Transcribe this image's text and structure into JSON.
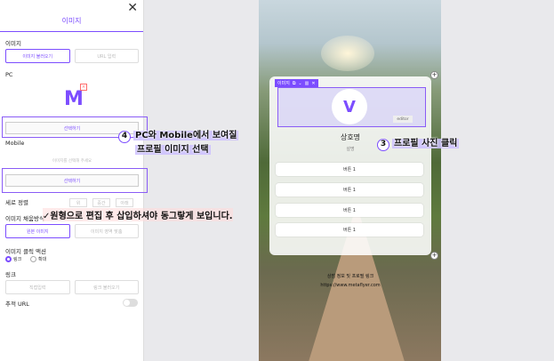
{
  "panel": {
    "title": "이미지",
    "section_image": "이미지",
    "image_tabs": [
      "이미지 불러오기",
      "URL 입력"
    ],
    "pc_label": "PC",
    "logo_letter": "M",
    "select_button_pc": "선택하기",
    "mobile_label": "Mobile",
    "mobile_hint": "이미지를 선택해 주세요",
    "select_button_mobile": "선택하기",
    "vertical_align_label": "세로 정렬",
    "vertical_align_options": [
      "위",
      "중간",
      "아래"
    ],
    "fill_label": "이미지 채움방식",
    "fill_options": [
      "원본 이미지",
      "이미지 영역 맞춤"
    ],
    "click_action_label": "이미지 클릭 액션",
    "click_action_options": [
      "링크",
      "확대"
    ],
    "link_label": "링크",
    "link_buttons": [
      "직접입력",
      "링크 불러오기"
    ],
    "tracking_label": "추적 URL"
  },
  "preview": {
    "toolbar": [
      "이미지",
      "⧉",
      "⌄",
      "▥",
      "✕"
    ],
    "avatar_letter": "V",
    "editor_tag": "editor",
    "shop_name": "상호명",
    "shop_desc": "설명",
    "link_buttons": [
      "버튼 1",
      "버튼 1",
      "버튼 1",
      "버튼 1"
    ],
    "footer_line1": "상점 정보 및 프로필 링크",
    "footer_url": "https://www.metaflyer.com"
  },
  "annotations": {
    "step4_num": "4",
    "step4_line1": "PC와 Mobile에서 보여질",
    "step4_line2": "프로필 이미지 선택",
    "step3_num": "3",
    "step3_text": "프로필 사진 클릭",
    "red_note": "✓원형으로 편집 후 삽입하셔야 동그랗게 보입니다."
  },
  "colors": {
    "accent": "#7c4dff",
    "highlight": "#cbbeff"
  }
}
